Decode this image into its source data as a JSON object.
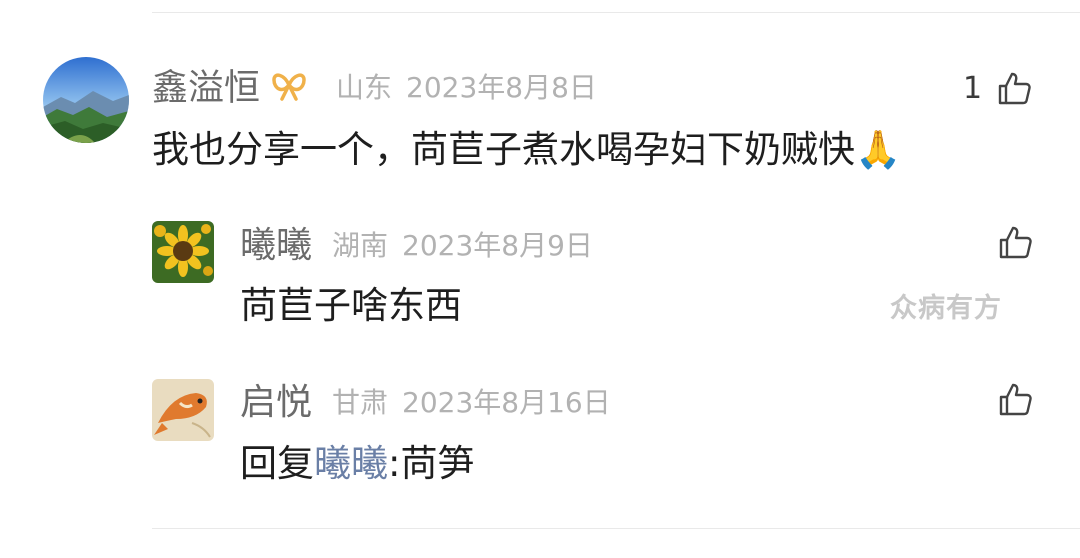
{
  "comments": [
    {
      "user": "鑫溢恒",
      "location": "山东",
      "date": "2023年8月8日",
      "likes": "1",
      "text": "我也分享一个，苘苣子煮水喝孕妇下奶贼快🙏",
      "avatar_icon": "mountain-landscape-icon",
      "badge_icon": "infinity-ribbon-icon",
      "replies": [
        {
          "user": "曦曦",
          "location": "湖南",
          "date": "2023年8月9日",
          "text": "苘苣子啥东西",
          "avatar_icon": "sunflower-icon"
        },
        {
          "user": "启悦",
          "location": "甘肃",
          "date": "2023年8月16日",
          "reply_prefix": "回复",
          "reply_to": "曦曦",
          "reply_body": ":苘笋",
          "avatar_icon": "koi-fish-icon"
        }
      ]
    }
  ],
  "watermark": "众病有方",
  "colors": {
    "name": "#6b6b6b",
    "meta": "#b2b2b2",
    "text": "#1e1e1e",
    "reply_link": "#6a7fa6",
    "watermark": "#c8c8c8"
  }
}
